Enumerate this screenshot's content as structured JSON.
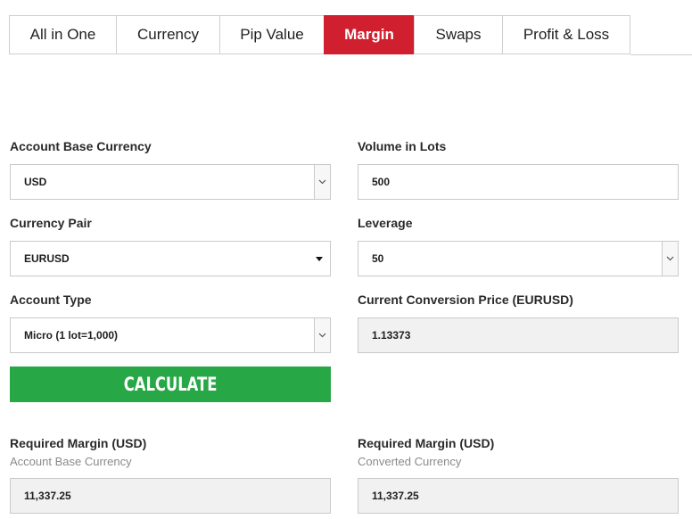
{
  "tabs": [
    {
      "label": "All in One",
      "active": false
    },
    {
      "label": "Currency",
      "active": false
    },
    {
      "label": "Pip Value",
      "active": false
    },
    {
      "label": "Margin",
      "active": true
    },
    {
      "label": "Swaps",
      "active": false
    },
    {
      "label": "Profit & Loss",
      "active": false
    }
  ],
  "form": {
    "account_base_currency": {
      "label": "Account Base Currency",
      "value": "USD"
    },
    "volume_in_lots": {
      "label": "Volume in Lots",
      "value": "500"
    },
    "currency_pair": {
      "label": "Currency Pair",
      "value": "EURUSD"
    },
    "leverage": {
      "label": "Leverage",
      "value": "50"
    },
    "account_type": {
      "label": "Account Type",
      "value": "Micro (1 lot=1,000)"
    },
    "conversion_price": {
      "label": "Current Conversion Price (EURUSD)",
      "value": "1.13373"
    },
    "calculate_label": "CALCULATE"
  },
  "results": {
    "base": {
      "label": "Required Margin (USD)",
      "sublabel": "Account Base Currency",
      "value": "11,337.25"
    },
    "converted": {
      "label": "Required Margin (USD)",
      "sublabel": "Converted Currency",
      "value": "11,337.25"
    }
  },
  "colors": {
    "accent": "#d01f2e",
    "button": "#27a745"
  }
}
